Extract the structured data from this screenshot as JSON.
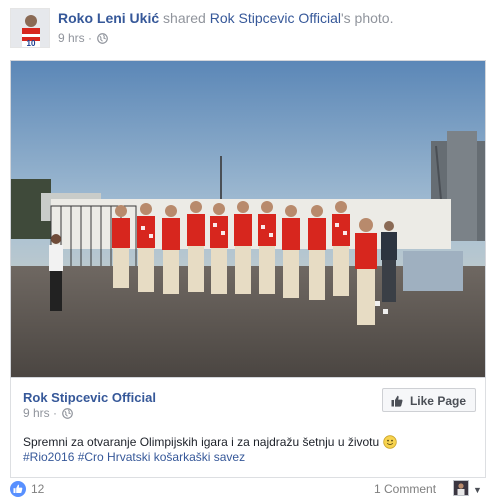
{
  "post": {
    "author": "Roko Leni Ukić",
    "action": "shared",
    "original_author": "Rok Stipcevic Official",
    "object": "'s photo.",
    "time": "9 hrs",
    "separator": "·"
  },
  "photo": {
    "subject": "team-photo"
  },
  "shared_page": {
    "name": "Rok Stipcevic Official",
    "time": "9 hrs",
    "separator": "·",
    "like_page_label": "Like Page",
    "text": "Spremni za otvaranje Olimpijskih igara i za najdražu šetnju u životu",
    "hashtags": "#Rio2016 #Cro Hrvatski košarkaški savez"
  },
  "reactions": {
    "like_count": "12",
    "comment_label": "1 Comment"
  },
  "colors": {
    "link": "#365899",
    "meta": "#90949c",
    "like_blue": "#5890ff",
    "jersey_red": "#d7261e"
  },
  "icons": [
    "globe-icon",
    "thumbs-up-icon",
    "smiley-icon",
    "like-reaction-icon",
    "caret-down-icon"
  ]
}
